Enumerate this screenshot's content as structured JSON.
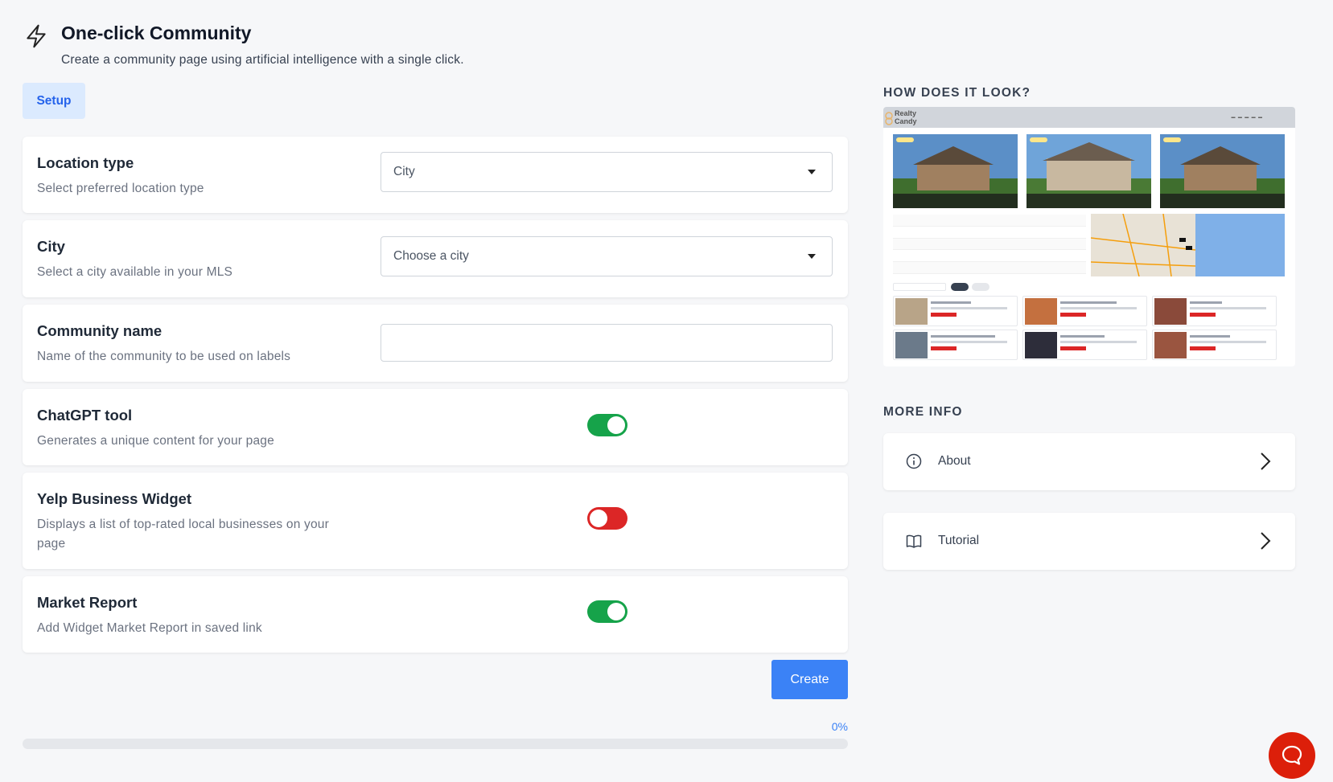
{
  "page": {
    "title": "One-click Community",
    "subtitle": "Create a community page using artificial intelligence with a single click."
  },
  "tabs": [
    {
      "label": "Setup",
      "active": true
    }
  ],
  "form": {
    "location_type": {
      "title": "Location type",
      "description": "Select preferred location type",
      "value": "City"
    },
    "city": {
      "title": "City",
      "description": "Select a city available in your MLS",
      "placeholder": "Choose a city"
    },
    "community_name": {
      "title": "Community name",
      "description": "Name of the community to be used on labels",
      "value": ""
    },
    "chatgpt_tool": {
      "title": "ChatGPT tool",
      "description": "Generates a unique content for your page",
      "enabled": true
    },
    "yelp_widget": {
      "title": "Yelp Business Widget",
      "description": "Displays a list of top-rated local businesses on your page",
      "enabled": false
    },
    "market_report": {
      "title": "Market Report",
      "description": "Add Widget Market Report in saved link",
      "enabled": true
    }
  },
  "actions": {
    "create_label": "Create"
  },
  "progress": {
    "percent": 0,
    "label": "0%"
  },
  "side": {
    "preview_heading": "HOW DOES IT LOOK?",
    "preview_brand": "Realty Candy",
    "more_info_heading": "MORE INFO",
    "links": [
      {
        "label": "About",
        "icon": "info-circle-icon"
      },
      {
        "label": "Tutorial",
        "icon": "book-icon"
      }
    ]
  },
  "colors": {
    "accent": "#3b82f6",
    "toggle_on": "#16a34a",
    "toggle_off": "#dc2626",
    "chat": "#dc1f0a"
  }
}
